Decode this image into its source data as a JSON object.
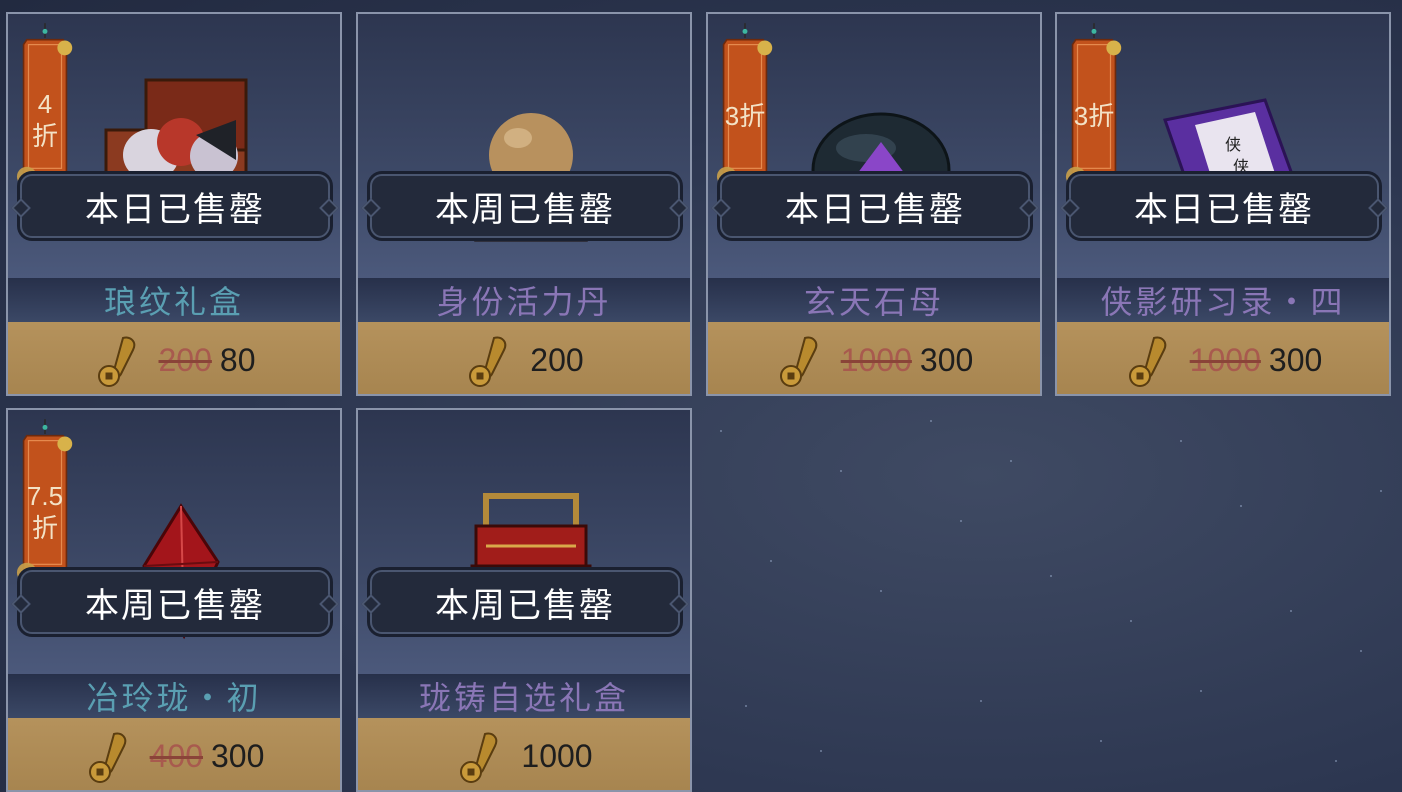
{
  "colors": {
    "name_teal": "#5a9fb2",
    "name_purple": "#8a76b6",
    "tag_orange": "#c2521c",
    "price_bg": "#ad8a54"
  },
  "currency_icon": "coin-icon",
  "cards": [
    {
      "discount": "4\n折",
      "status": "本日已售罄",
      "name": "琅纹礼盒",
      "name_color": "teal",
      "old_price": "200",
      "price": "80",
      "art": "gift-chest-icon"
    },
    {
      "discount": "",
      "status": "本周已售罄",
      "name": "身份活力丹",
      "name_color": "purple",
      "old_price": "",
      "price": "200",
      "art": "orb-pill-icon"
    },
    {
      "discount": "3折",
      "status": "本日已售罄",
      "name": "玄天石母",
      "name_color": "purple",
      "old_price": "1000",
      "price": "300",
      "art": "black-stone-icon"
    },
    {
      "discount": "3折",
      "status": "本日已售罄",
      "name": "侠影研习录・四",
      "name_color": "purple",
      "old_price": "1000",
      "price": "300",
      "art": "scroll-book-icon"
    },
    {
      "discount": "7.5\n折",
      "status": "本周已售罄",
      "name": "冶玲珑・初",
      "name_color": "teal",
      "old_price": "400",
      "price": "300",
      "art": "red-crystal-icon"
    },
    {
      "discount": "",
      "status": "本周已售罄",
      "name": "珑铸自选礼盒",
      "name_color": "purple",
      "old_price": "",
      "price": "1000",
      "art": "lacquer-box-icon"
    }
  ]
}
